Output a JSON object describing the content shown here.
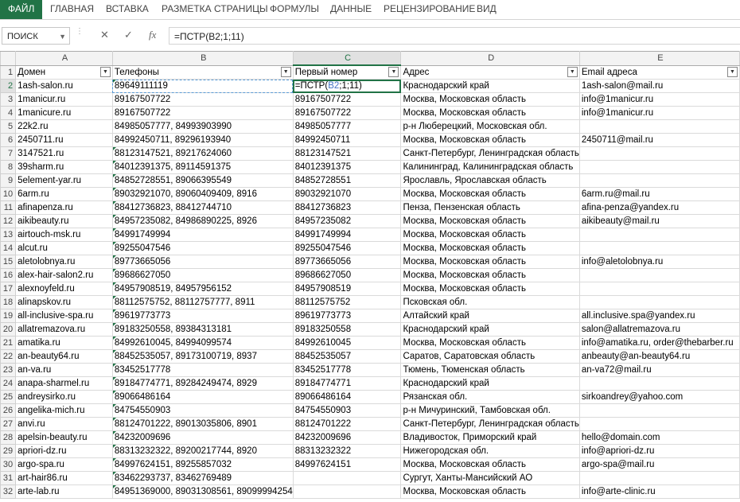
{
  "ribbon": {
    "tabs": [
      "ФАЙЛ",
      "ГЛАВНАЯ",
      "ВСТАВКА",
      "РАЗМЕТКА СТРАНИЦЫ",
      "ФОРМУЛЫ",
      "ДАННЫЕ",
      "РЕЦЕНЗИРОВАНИЕ",
      "ВИД"
    ]
  },
  "formula_bar": {
    "name_box": "ПОИСК",
    "cancel": "✕",
    "confirm": "✓",
    "fx": "fx",
    "formula": "=ПСТР(B2;1;11)"
  },
  "columns": [
    "A",
    "B",
    "C",
    "D",
    "E"
  ],
  "headers": [
    "Домен",
    "Телефоны",
    "Первый номер",
    "Адрес",
    "Email адреса"
  ],
  "active_cell_parts": [
    "=ПСТР(",
    "B2",
    ";1;11)"
  ],
  "rows": [
    [
      "1ash-salon.ru",
      "89649111119",
      "",
      "Краснодарский край",
      "1ash-salon@mail.ru"
    ],
    [
      "1manicur.ru",
      "89167507722",
      "89167507722",
      "Москва, Московская область",
      "info@1manicur.ru"
    ],
    [
      "1manicure.ru",
      "89167507722",
      "89167507722",
      "Москва, Московская область",
      "info@1manicur.ru"
    ],
    [
      "22k2.ru",
      "84985057777, 84993903990",
      "84985057777",
      "р-н Люберецкий, Московская обл.",
      ""
    ],
    [
      "2450711.ru",
      "84992450711, 89296193940",
      "84992450711",
      "Москва, Московская область",
      "2450711@mail.ru"
    ],
    [
      "3147521.ru",
      "88123147521, 89217624060",
      "88123147521",
      "Санкт-Петербург, Ленинградская область",
      ""
    ],
    [
      "39sharm.ru",
      "84012391375, 89114591375",
      "84012391375",
      "Калининград, Калининградская область",
      ""
    ],
    [
      "5element-yar.ru",
      "84852728551, 89066395549",
      "84852728551",
      "Ярославль, Ярославская область",
      ""
    ],
    [
      "6arm.ru",
      "89032921070, 89060409409, 8916",
      "89032921070",
      "Москва, Московская область",
      "6arm.ru@mail.ru"
    ],
    [
      "afinapenza.ru",
      "88412736823, 88412744710",
      "88412736823",
      "Пенза, Пензенская область",
      "afina-penza@yandex.ru"
    ],
    [
      "aikibeauty.ru",
      "84957235082, 84986890225, 8926",
      "84957235082",
      "Москва, Московская область",
      "aikibeauty@mail.ru"
    ],
    [
      "airtouch-msk.ru",
      "84991749994",
      "84991749994",
      "Москва, Московская область",
      ""
    ],
    [
      "alcut.ru",
      "89255047546",
      "89255047546",
      "Москва, Московская область",
      ""
    ],
    [
      "aletolobnya.ru",
      "89773665056",
      "89773665056",
      "Москва, Московская область",
      "info@aletolobnya.ru"
    ],
    [
      "alex-hair-salon2.ru",
      "89686627050",
      "89686627050",
      "Москва, Московская область",
      ""
    ],
    [
      "alexnoyfeld.ru",
      "84957908519, 84957956152",
      "84957908519",
      "Москва, Московская область",
      ""
    ],
    [
      "alinapskov.ru",
      "88112575752, 88112757777, 8911",
      "88112575752",
      "Псковская обл.",
      ""
    ],
    [
      "all-inclusive-spa.ru",
      "89619773773",
      "89619773773",
      "Алтайский край",
      "all.inclusive.spa@yandex.ru"
    ],
    [
      "allatremazova.ru",
      "89183250558, 89384313181",
      "89183250558",
      "Краснодарский край",
      "salon@allatremazova.ru"
    ],
    [
      "amatika.ru",
      "84992610045, 84994099574",
      "84992610045",
      "Москва, Московская область",
      "info@amatika.ru, order@thebarber.ru"
    ],
    [
      "an-beauty64.ru",
      "88452535057, 89173100719, 8937",
      "88452535057",
      "Саратов, Саратовская область",
      "anbeauty@an-beauty64.ru"
    ],
    [
      "an-va.ru",
      "83452517778",
      "83452517778",
      "Тюмень, Тюменская область",
      "an-va72@mail.ru"
    ],
    [
      "anapa-sharmel.ru",
      "89184774771, 89284249474, 8929",
      "89184774771",
      "Краснодарский край",
      ""
    ],
    [
      "andreysirko.ru",
      "89066486164",
      "89066486164",
      "Рязанская обл.",
      "sirkoandrey@yahoo.com"
    ],
    [
      "angelika-mich.ru",
      "84754550903",
      "84754550903",
      "р-н Мичуринский, Тамбовская обл.",
      ""
    ],
    [
      "anvi.ru",
      "88124701222, 89013035806, 8901",
      "88124701222",
      "Санкт-Петербург, Ленинградская область",
      ""
    ],
    [
      "apelsin-beauty.ru",
      "84232009696",
      "84232009696",
      "Владивосток, Приморский край",
      "hello@domain.com"
    ],
    [
      "apriori-dz.ru",
      "88313232322, 89200217744, 8920",
      "88313232322",
      "Нижегородская обл.",
      "info@apriori-dz.ru"
    ],
    [
      "argo-spa.ru",
      "84997624151, 89255857032",
      "84997624151",
      "Москва, Московская область",
      "argo-spa@mail.ru"
    ],
    [
      "art-hair86.ru",
      "83462293737, 83462769489",
      "",
      "Сургут, Ханты-Мансийский АО",
      ""
    ],
    [
      "arte-lab.ru",
      "84951369000, 89031308561, 89099994254",
      "",
      "Москва, Московская область",
      "info@arte-clinic.ru"
    ]
  ],
  "green_marker_rows": [
    2,
    7,
    8,
    9,
    10,
    11,
    12,
    13,
    14,
    15,
    16,
    17,
    18,
    19,
    20,
    21,
    22,
    23,
    24,
    25,
    26,
    27,
    28,
    29,
    30,
    31,
    32
  ]
}
